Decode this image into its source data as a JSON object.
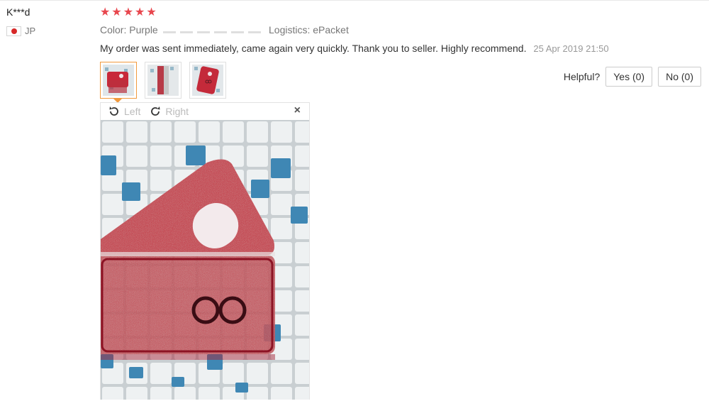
{
  "reviewer": {
    "name": "K***d",
    "country_code": "JP"
  },
  "rating": {
    "stars": 5,
    "max": 5,
    "color": "#e8474e"
  },
  "attributes": {
    "color_label": "Color:",
    "color_value": "Purple",
    "logistics_label": "Logistics:",
    "logistics_value": "ePacket"
  },
  "review": {
    "text": "My order was sent immediately, came again very quickly. Thank you to seller. Highly recommend.",
    "date": "25 Apr 2019 21:50"
  },
  "helpful": {
    "label": "Helpful?",
    "yes_label": "Yes (0)",
    "no_label": "No (0)"
  },
  "viewer": {
    "rotate_left_label": "Left",
    "rotate_right_label": "Right",
    "close_label": "×"
  },
  "colors": {
    "accent": "#f19a3e",
    "case_red": "#c8283a"
  }
}
